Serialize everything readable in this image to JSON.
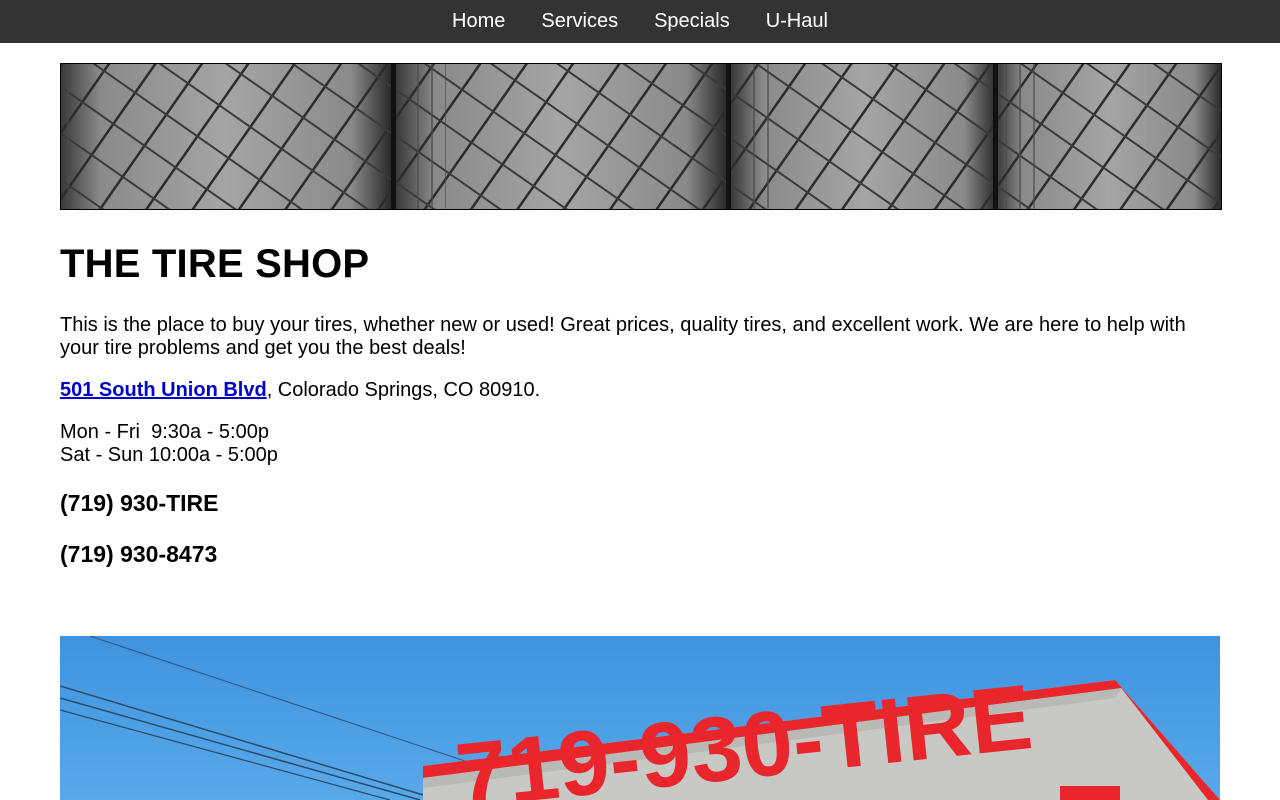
{
  "nav": {
    "items": [
      "Home",
      "Services",
      "Specials",
      "U-Haul"
    ]
  },
  "page": {
    "title": "THE TIRE SHOP",
    "intro": "This is the place to buy your tires, whether new or used! Great prices, quality tires, and excellent work.  We are here to help with your tire problems and get you the best deals!",
    "address_link": "501 South Union Blvd",
    "address_rest": ", Colorado Springs, CO 80910.",
    "hours": [
      "Mon - Fri  9:30a - 5:00p",
      "Sat - Sun 10:00a - 5:00p"
    ],
    "phone_vanity": "(719) 930-TIRE",
    "phone_number": "(719) 930-8473"
  },
  "storefront_sign": "719-930-TIRE",
  "colors": {
    "nav_bg": "#333333",
    "nav_text": "#ffffff",
    "link": "#0000cc",
    "sky": "#4a9be0",
    "sign_red": "#e8262c"
  }
}
